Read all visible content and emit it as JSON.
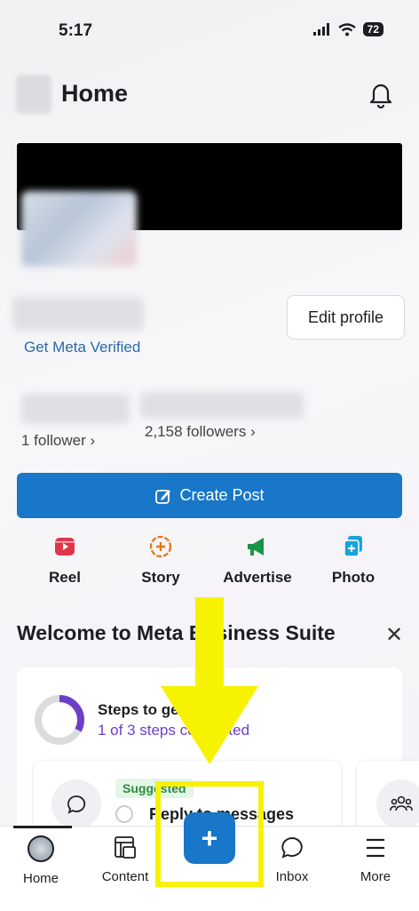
{
  "status": {
    "time": "5:17",
    "battery": "72"
  },
  "header": {
    "title": "Home"
  },
  "profile": {
    "edit_label": "Edit profile",
    "verified_link": "Get Meta Verified",
    "follower_count_a": "1 follower",
    "follower_count_b": "2,158 followers"
  },
  "create_post_label": "Create Post",
  "actions": [
    {
      "label": "Reel",
      "icon": "reel-icon",
      "color": "#e0354a"
    },
    {
      "label": "Story",
      "icon": "story-icon",
      "color": "#e07a16"
    },
    {
      "label": "Advertise",
      "icon": "megaphone-icon",
      "color": "#1a9446"
    },
    {
      "label": "Photo",
      "icon": "photo-icon",
      "color": "#1aa3d8"
    }
  ],
  "welcome": {
    "title": "Welcome to Meta Business Suite",
    "steps_title": "Steps to get started",
    "steps_sub": "1 of 3 steps completed",
    "steps_progress": 0.33,
    "badge": "Suggested",
    "task": "Reply to messages"
  },
  "bottom_nav": [
    {
      "label": "Home",
      "icon": "avatar"
    },
    {
      "label": "Content",
      "icon": "content-icon"
    },
    {
      "label": "",
      "icon": "plus-icon"
    },
    {
      "label": "Inbox",
      "icon": "chat-icon"
    },
    {
      "label": "More",
      "icon": "menu-icon"
    }
  ],
  "colors": {
    "accent": "#1877c8",
    "progress": "#6b3fc7",
    "annotation": "#f7f200"
  }
}
